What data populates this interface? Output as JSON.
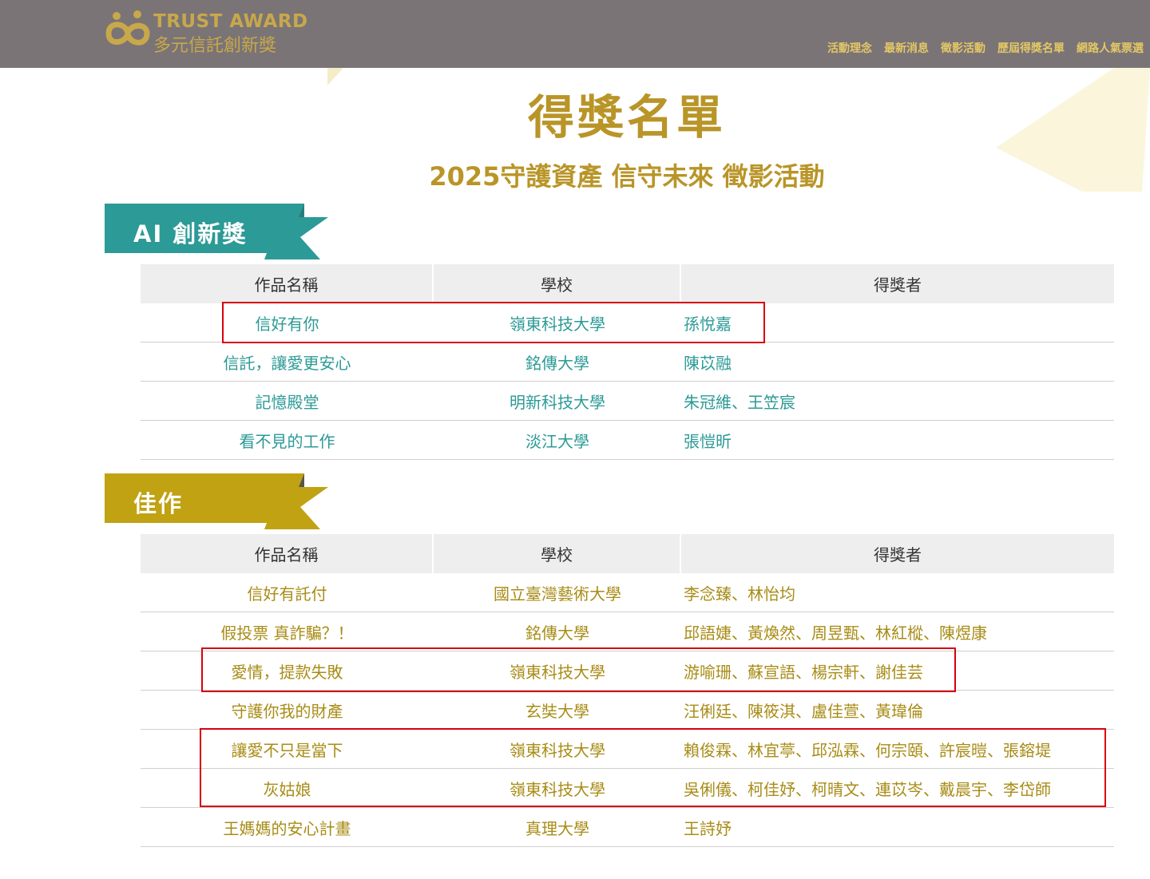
{
  "header": {
    "logo_en": "TRUST AWARD",
    "logo_zh": "多元信託創新獎",
    "nav": [
      "活動理念",
      "最新消息",
      "徵影活動",
      "歷屆得獎名單",
      "網路人氣票選"
    ]
  },
  "page": {
    "title": "得獎名單",
    "subtitle": "2025守護資產 信守未來 徵影活動"
  },
  "colors": {
    "gold": "#b99528",
    "teal": "#2c9a96",
    "ribbon_gold": "#c0a212",
    "highlight": "#d7000f"
  },
  "sections": [
    {
      "label": "AI 創新獎",
      "headers": [
        "作品名稱",
        "學校",
        "得獎者"
      ],
      "rows": [
        [
          "信好有你",
          "嶺東科技大學",
          "孫悅嘉"
        ],
        [
          "信託，讓愛更安心",
          "銘傳大學",
          "陳苡融"
        ],
        [
          "記憶殿堂",
          "明新科技大學",
          "朱冠維、王笠宸"
        ],
        [
          "看不見的工作",
          "淡江大學",
          "張愷昕"
        ]
      ]
    },
    {
      "label": "佳作",
      "headers": [
        "作品名稱",
        "學校",
        "得獎者"
      ],
      "rows": [
        [
          "信好有託付",
          "國立臺灣藝術大學",
          "李念臻、林怡均"
        ],
        [
          "假投票 真詐騙？！",
          "銘傳大學",
          "邱語婕、黃煥然、周昱甄、林紅樅、陳煜康"
        ],
        [
          "愛情，提款失敗",
          "嶺東科技大學",
          "游喻珊、蘇宣語、楊宗軒、謝佳芸"
        ],
        [
          "守護你我的財產",
          "玄奘大學",
          "汪俐廷、陳筱淇、盧佳萱、黃瑋倫"
        ],
        [
          "讓愛不只是當下",
          "嶺東科技大學",
          "賴俊霖、林宜葶、邱泓霖、何宗頤、許宸暟、張鎔堤"
        ],
        [
          "灰姑娘",
          "嶺東科技大學",
          "吳俐儀、柯佳妤、柯晴文、連苡岑、戴晨宇、李岱師"
        ],
        [
          "王媽媽的安心計畫",
          "真理大學",
          "王詩妤"
        ]
      ]
    }
  ]
}
